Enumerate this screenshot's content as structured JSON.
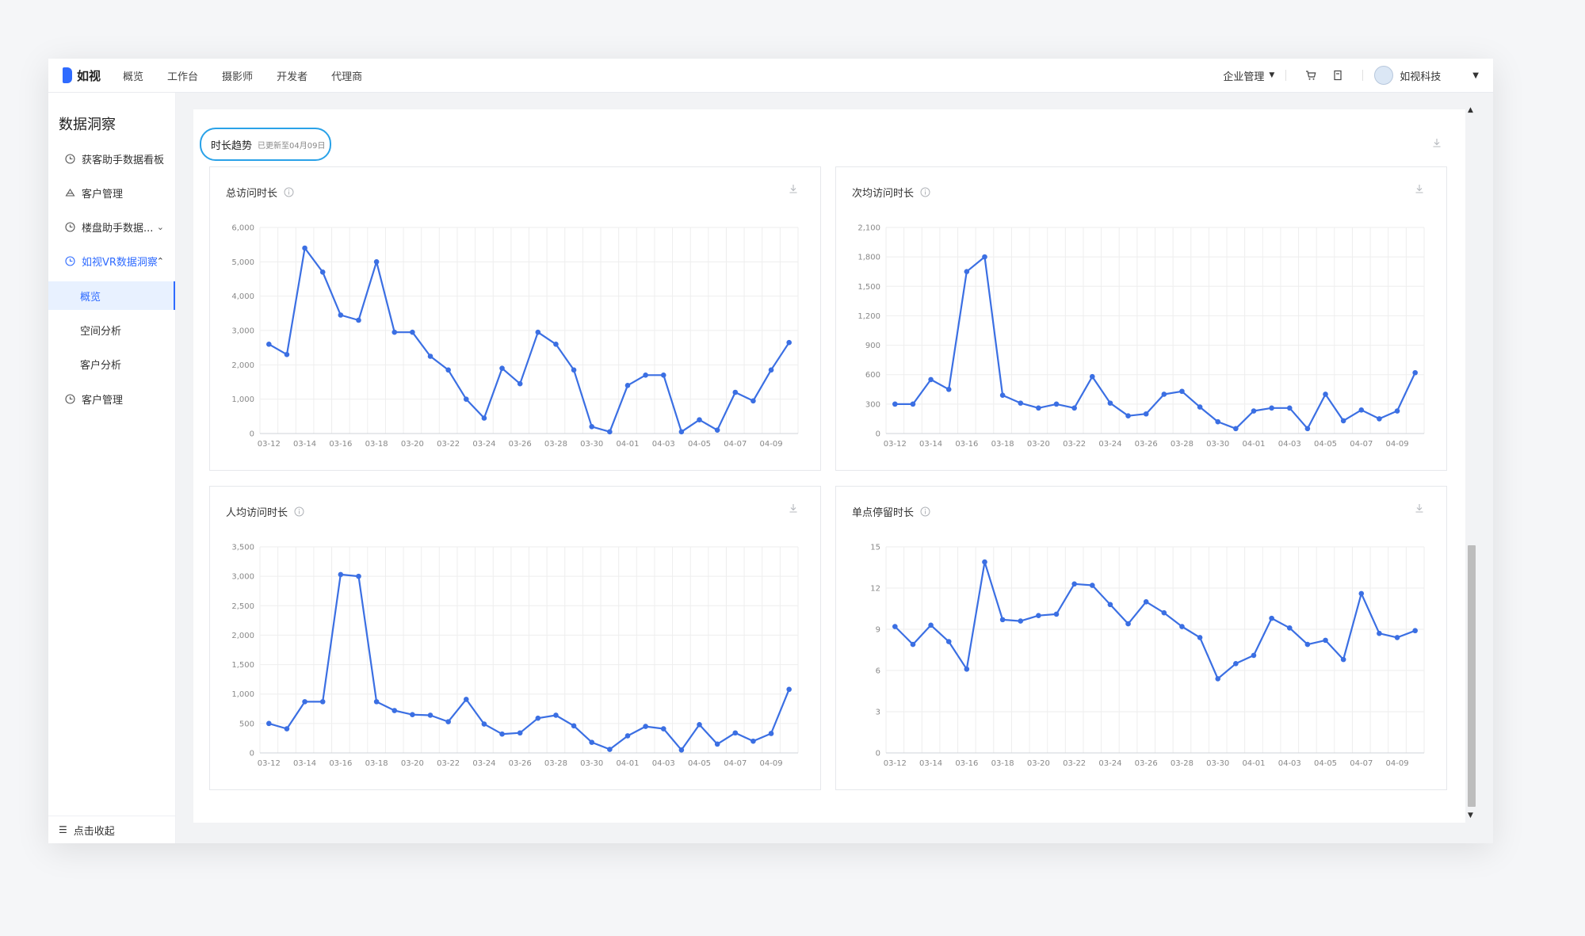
{
  "app": {
    "logo_text": "如视",
    "nav": [
      "概览",
      "工作台",
      "摄影师",
      "开发者",
      "代理商"
    ],
    "org_menu": "企业管理",
    "user_name": "如视科技"
  },
  "sidebar": {
    "title": "数据洞察",
    "items": [
      {
        "label": "获客助手数据看板",
        "icon": "chart-icon"
      },
      {
        "label": "客户管理",
        "icon": "users-icon"
      },
      {
        "label": "楼盘助手数据...",
        "icon": "chart-icon"
      },
      {
        "label": "如视VR数据洞察",
        "icon": "chart-icon"
      },
      {
        "label": "客户管理",
        "icon": "chart-icon"
      }
    ],
    "sub_items": [
      "概览",
      "空间分析",
      "客户分析"
    ],
    "active_sub": "概览",
    "collapse_label": "点击收起"
  },
  "section": {
    "title": "时长趋势",
    "updated": "已更新至04月09日"
  },
  "colors": {
    "accent": "#2f6bff",
    "line": "#3b6fe3",
    "highlight_ring": "#2aa2e8"
  },
  "chart_data": [
    {
      "type": "line",
      "title": "总访问时长",
      "x": [
        "03-12",
        "03-13",
        "03-14",
        "03-15",
        "03-16",
        "03-17",
        "03-18",
        "03-19",
        "03-20",
        "03-21",
        "03-22",
        "03-23",
        "03-24",
        "03-25",
        "03-26",
        "03-27",
        "03-28",
        "03-29",
        "03-30",
        "03-31",
        "04-01",
        "04-02",
        "04-03",
        "04-04",
        "04-05",
        "04-06",
        "04-07",
        "04-08",
        "04-09",
        "04-10"
      ],
      "values": [
        2600,
        2300,
        5400,
        4700,
        3450,
        3300,
        5000,
        2950,
        2950,
        2250,
        1850,
        1000,
        450,
        1900,
        1450,
        2950,
        2600,
        1850,
        200,
        50,
        1400,
        1700,
        1700,
        50,
        400,
        100,
        1200,
        950,
        1850,
        2650
      ],
      "ylim": [
        0,
        6000
      ],
      "yticks": [
        0,
        1000,
        2000,
        3000,
        4000,
        5000,
        6000
      ],
      "ytick_labels": [
        "0",
        "1,000",
        "2,000",
        "3,000",
        "4,000",
        "5,000",
        "6,000"
      ],
      "xtick_labels": [
        "03-12",
        "03-14",
        "03-16",
        "03-18",
        "03-20",
        "03-22",
        "03-24",
        "03-26",
        "03-28",
        "03-30",
        "04-01",
        "04-03",
        "04-05",
        "04-07",
        "04-09"
      ],
      "grid": true
    },
    {
      "type": "line",
      "title": "次均访问时长",
      "x": [
        "03-12",
        "03-13",
        "03-14",
        "03-15",
        "03-16",
        "03-17",
        "03-18",
        "03-19",
        "03-20",
        "03-21",
        "03-22",
        "03-23",
        "03-24",
        "03-25",
        "03-26",
        "03-27",
        "03-28",
        "03-29",
        "03-30",
        "03-31",
        "04-01",
        "04-02",
        "04-03",
        "04-04",
        "04-05",
        "04-06",
        "04-07",
        "04-08",
        "04-09",
        "04-10"
      ],
      "values": [
        300,
        300,
        550,
        450,
        1650,
        1800,
        390,
        310,
        260,
        300,
        260,
        580,
        310,
        180,
        200,
        400,
        430,
        270,
        120,
        50,
        230,
        260,
        260,
        50,
        400,
        130,
        240,
        150,
        230,
        620
      ],
      "ylim": [
        0,
        2100
      ],
      "yticks": [
        0,
        300,
        600,
        900,
        1200,
        1500,
        1800,
        2100
      ],
      "ytick_labels": [
        "0",
        "300",
        "600",
        "900",
        "1,200",
        "1,500",
        "1,800",
        "2,100"
      ],
      "xtick_labels": [
        "03-12",
        "03-14",
        "03-16",
        "03-18",
        "03-20",
        "03-22",
        "03-24",
        "03-26",
        "03-28",
        "03-30",
        "04-01",
        "04-03",
        "04-05",
        "04-07",
        "04-09"
      ],
      "grid": true
    },
    {
      "type": "line",
      "title": "人均访问时长",
      "x": [
        "03-12",
        "03-13",
        "03-14",
        "03-15",
        "03-16",
        "03-17",
        "03-18",
        "03-19",
        "03-20",
        "03-21",
        "03-22",
        "03-23",
        "03-24",
        "03-25",
        "03-26",
        "03-27",
        "03-28",
        "03-29",
        "03-30",
        "03-31",
        "04-01",
        "04-02",
        "04-03",
        "04-04",
        "04-05",
        "04-06",
        "04-07",
        "04-08",
        "04-09",
        "04-10"
      ],
      "values": [
        500,
        410,
        870,
        870,
        3030,
        3000,
        870,
        720,
        650,
        640,
        530,
        910,
        490,
        320,
        340,
        590,
        640,
        460,
        180,
        60,
        290,
        450,
        410,
        50,
        480,
        150,
        340,
        200,
        330,
        1080
      ],
      "ylim": [
        0,
        3500
      ],
      "yticks": [
        0,
        500,
        1000,
        1500,
        2000,
        2500,
        3000,
        3500
      ],
      "ytick_labels": [
        "0",
        "500",
        "1,000",
        "1,500",
        "2,000",
        "2,500",
        "3,000",
        "3,500"
      ],
      "xtick_labels": [
        "03-12",
        "03-14",
        "03-16",
        "03-18",
        "03-20",
        "03-22",
        "03-24",
        "03-26",
        "03-28",
        "03-30",
        "04-01",
        "04-03",
        "04-05",
        "04-07",
        "04-09"
      ],
      "grid": true
    },
    {
      "type": "line",
      "title": "单点停留时长",
      "x": [
        "03-12",
        "03-13",
        "03-14",
        "03-15",
        "03-16",
        "03-17",
        "03-18",
        "03-19",
        "03-20",
        "03-21",
        "03-22",
        "03-23",
        "03-24",
        "03-25",
        "03-26",
        "03-27",
        "03-28",
        "03-29",
        "03-30",
        "03-31",
        "04-01",
        "04-02",
        "04-03",
        "04-04",
        "04-05",
        "04-06",
        "04-07",
        "04-08",
        "04-09",
        "04-10"
      ],
      "values": [
        9.2,
        7.9,
        9.3,
        8.1,
        6.1,
        13.9,
        9.7,
        9.6,
        10.0,
        10.1,
        12.3,
        12.2,
        10.8,
        9.4,
        11.0,
        10.2,
        9.2,
        8.4,
        5.4,
        6.5,
        7.1,
        9.8,
        9.1,
        7.9,
        8.2,
        6.8,
        11.6,
        8.7,
        8.4,
        8.9
      ],
      "ylim": [
        0,
        15
      ],
      "yticks": [
        0,
        3,
        6,
        9,
        12,
        15
      ],
      "ytick_labels": [
        "0",
        "3",
        "6",
        "9",
        "12",
        "15"
      ],
      "xtick_labels": [
        "03-12",
        "03-14",
        "03-16",
        "03-18",
        "03-20",
        "03-22",
        "03-24",
        "03-26",
        "03-28",
        "03-30",
        "04-01",
        "04-03",
        "04-05",
        "04-07",
        "04-09"
      ],
      "grid": true
    }
  ]
}
